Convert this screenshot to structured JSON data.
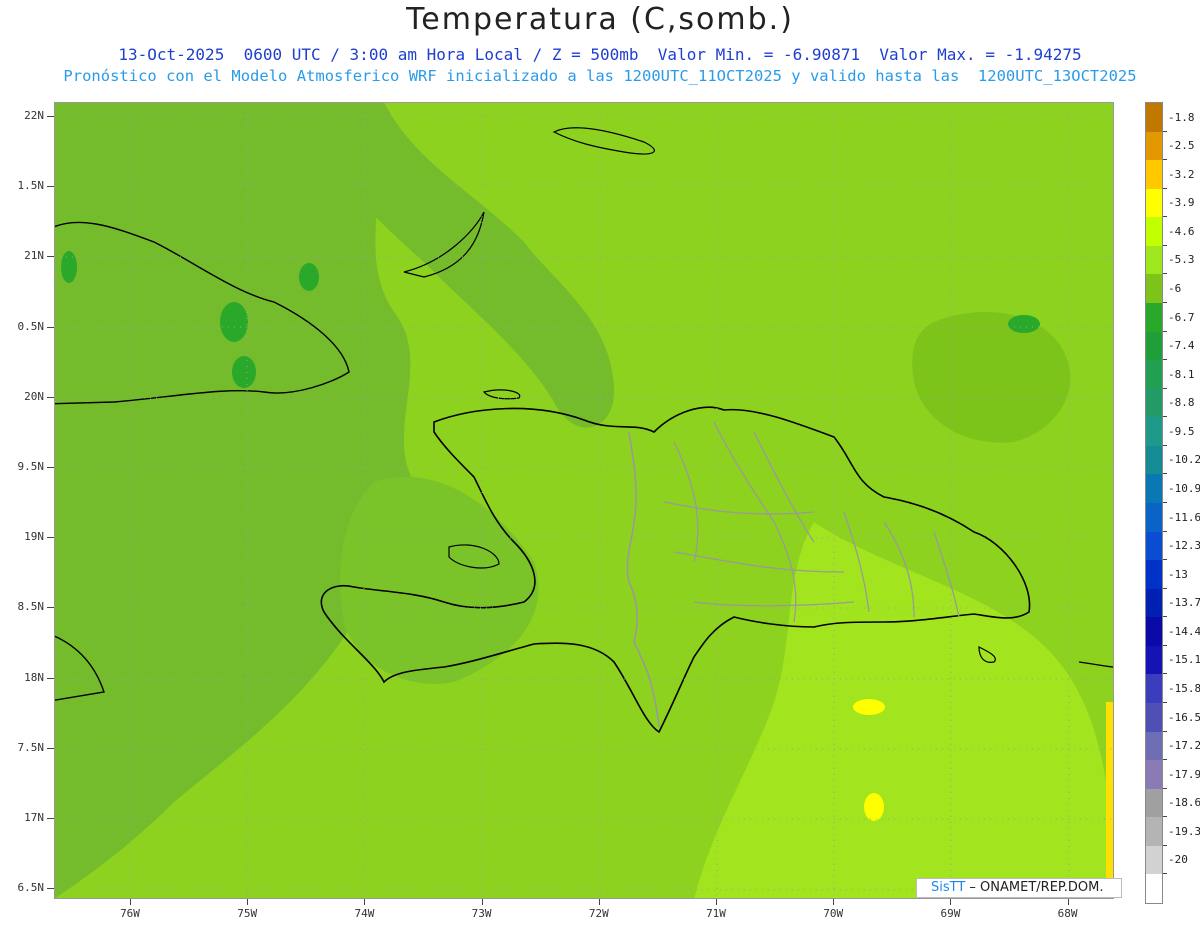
{
  "header": {
    "title": "Temperatura (C,somb.)",
    "subtitle_line1": "13-Oct-2025  0600 UTC / 3:00 am Hora Local / Z = 500mb  Valor Min. = -6.90871  Valor Max. = -1.94275",
    "subtitle_line2": "Pronóstico con el Modelo Atmosferico WRF inicializado a las 1200UTC_11OCT2025 y valido hasta las  1200UTC_13OCT2025"
  },
  "axes": {
    "lat_labels": [
      "22N",
      "1.5N",
      "21N",
      "0.5N",
      "20N",
      "9.5N",
      "19N",
      "8.5N",
      "18N",
      "7.5N",
      "17N",
      "6.5N"
    ],
    "lon_labels": [
      "76W",
      "75W",
      "74W",
      "73W",
      "72W",
      "71W",
      "70W",
      "69W",
      "68W"
    ]
  },
  "colorbar": {
    "labels": [
      "-1.8",
      "-2.5",
      "-3.2",
      "-3.9",
      "-4.6",
      "-5.3",
      "-6",
      "-6.7",
      "-7.4",
      "-8.1",
      "-8.8",
      "-9.5",
      "-10.2",
      "-10.9",
      "-11.6",
      "-12.3",
      "-13",
      "-13.7",
      "-14.4",
      "-15.1",
      "-15.8",
      "-16.5",
      "-17.2",
      "-17.9",
      "-18.6",
      "-19.3",
      "-20"
    ],
    "colors": [
      "#c07800",
      "#e39700",
      "#ffc800",
      "#ffff00",
      "#c2ff00",
      "#9ee61e",
      "#7cc41a",
      "#2aa82a",
      "#1f9e3a",
      "#20a050",
      "#239a68",
      "#1e9a8a",
      "#148c96",
      "#0a78b4",
      "#0a64c8",
      "#0a4cd2",
      "#0032c8",
      "#0020b4",
      "#0a0aa8",
      "#1414b4",
      "#3c3cbe",
      "#5050b4",
      "#6e6eb4",
      "#8c7ab4",
      "#a0a0a0",
      "#b4b4b4",
      "#d2d2d2",
      "#ffffff"
    ]
  },
  "legend_colors": {
    "base_field": "#8cd21e",
    "cool_zone": "#74bc2c",
    "warm_zone": "#aaea1e",
    "coast_line": "#000000",
    "province_line": "#9a9a9a"
  },
  "credit": {
    "brand": "SisTT",
    "text": " –  ONAMET/REP.DOM."
  }
}
